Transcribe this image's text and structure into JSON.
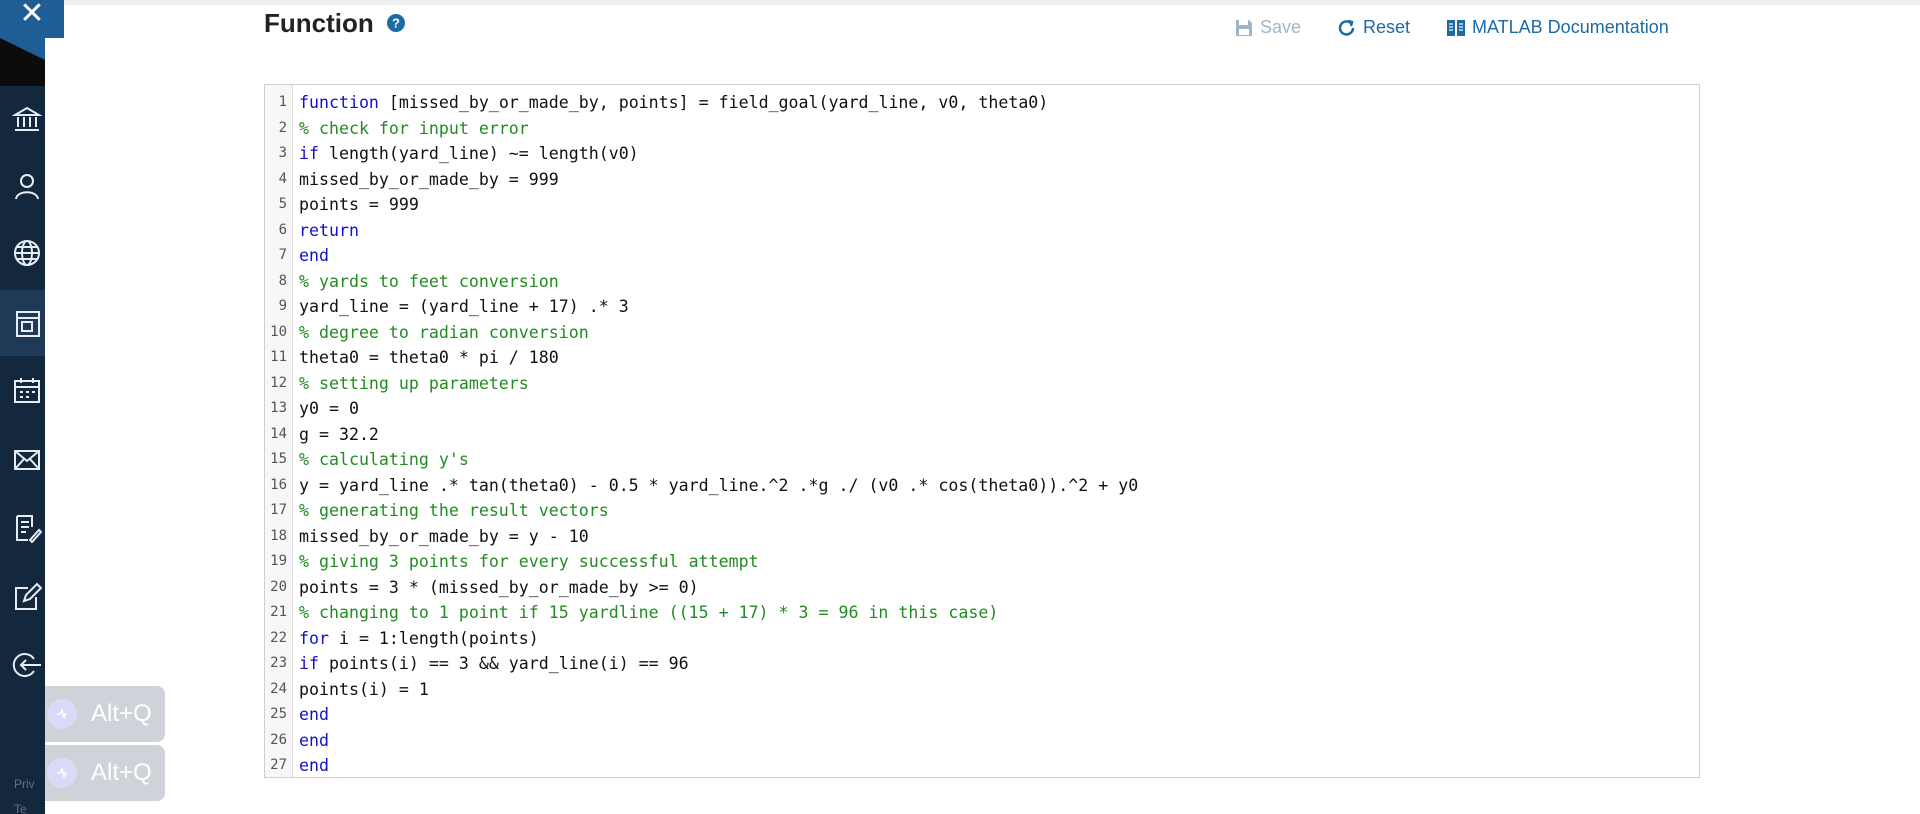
{
  "header": {
    "title": "Function",
    "help_icon": "question-circle-icon",
    "save_label": "Save",
    "reset_label": "Reset",
    "docs_label": "MATLAB Documentation"
  },
  "close": {
    "icon": "close-icon",
    "symbol": "✕"
  },
  "sidebar": {
    "icons": [
      "bank-icon",
      "user-icon",
      "globe-icon",
      "course-icon",
      "calendar-icon",
      "mail-icon",
      "edit-list-icon",
      "edit-box-icon",
      "logout-icon"
    ],
    "footer": [
      "Priv",
      "Te"
    ]
  },
  "overlay": {
    "badge_label": "Alt+Q"
  },
  "colors": {
    "keyword": "#1111cc",
    "comment": "#228b22",
    "sidebar": "#13273d",
    "link": "#1d6ba5"
  },
  "editor": {
    "lines": [
      {
        "n": "1",
        "kw": "function",
        "rest": " [missed_by_or_made_by, points] = field_goal(yard_line, v0, theta0)",
        "cm": ""
      },
      {
        "n": "2",
        "kw": "",
        "rest": "",
        "cm": "% check for input error"
      },
      {
        "n": "3",
        "kw": "if",
        "rest": " length(yard_line) ~= length(v0)",
        "cm": ""
      },
      {
        "n": "4",
        "kw": "",
        "rest": "missed_by_or_made_by = 999",
        "cm": ""
      },
      {
        "n": "5",
        "kw": "",
        "rest": "points = 999",
        "cm": ""
      },
      {
        "n": "6",
        "kw": "return",
        "rest": "",
        "cm": ""
      },
      {
        "n": "7",
        "kw": "end",
        "rest": "",
        "cm": ""
      },
      {
        "n": "8",
        "kw": "",
        "rest": "",
        "cm": "% yards to feet conversion"
      },
      {
        "n": "9",
        "kw": "",
        "rest": "yard_line = (yard_line + 17) .* 3",
        "cm": ""
      },
      {
        "n": "10",
        "kw": "",
        "rest": "",
        "cm": "% degree to radian conversion"
      },
      {
        "n": "11",
        "kw": "",
        "rest": "theta0 = theta0 * pi / 180",
        "cm": ""
      },
      {
        "n": "12",
        "kw": "",
        "rest": "",
        "cm": "% setting up parameters"
      },
      {
        "n": "13",
        "kw": "",
        "rest": "y0 = 0",
        "cm": ""
      },
      {
        "n": "14",
        "kw": "",
        "rest": "g = 32.2",
        "cm": ""
      },
      {
        "n": "15",
        "kw": "",
        "rest": "",
        "cm": "% calculating y's"
      },
      {
        "n": "16",
        "kw": "",
        "rest": "y = yard_line .* tan(theta0) - 0.5 * yard_line.^2 .*g ./ (v0 .* cos(theta0)).^2 + y0",
        "cm": ""
      },
      {
        "n": "17",
        "kw": "",
        "rest": "",
        "cm": "% generating the result vectors"
      },
      {
        "n": "18",
        "kw": "",
        "rest": "missed_by_or_made_by = y - 10",
        "cm": ""
      },
      {
        "n": "19",
        "kw": "",
        "rest": "",
        "cm": "% giving 3 points for every successful attempt"
      },
      {
        "n": "20",
        "kw": "",
        "rest": "points = 3 * (missed_by_or_made_by >= 0)",
        "cm": ""
      },
      {
        "n": "21",
        "kw": "",
        "rest": "",
        "cm": "% changing to 1 point if 15 yardline ((15 + 17) * 3 = 96 in this case)"
      },
      {
        "n": "22",
        "kw": "for",
        "rest": " i = 1:length(points)",
        "cm": ""
      },
      {
        "n": "23",
        "kw": "if",
        "rest": " points(i) == 3 && yard_line(i) == 96",
        "cm": ""
      },
      {
        "n": "24",
        "kw": "",
        "rest": "points(i) = 1",
        "cm": ""
      },
      {
        "n": "25",
        "kw": "end",
        "rest": "",
        "cm": ""
      },
      {
        "n": "26",
        "kw": "end",
        "rest": "",
        "cm": ""
      },
      {
        "n": "27",
        "kw": "end",
        "rest": "",
        "cm": ""
      }
    ]
  }
}
